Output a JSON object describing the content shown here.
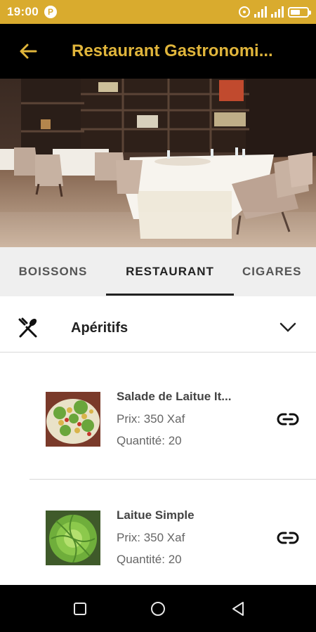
{
  "status_bar": {
    "time": "19:00",
    "notification_letter": "P"
  },
  "app_bar": {
    "title": "Restaurant Gastronomi..."
  },
  "tabs": [
    {
      "label": "BOISSONS"
    },
    {
      "label": "RESTAURANT"
    },
    {
      "label": "CIGARES"
    }
  ],
  "active_tab": "RESTAURANT",
  "section": {
    "title": "Apéritifs"
  },
  "items": [
    {
      "name": "Salade de Laitue It...",
      "price": "Prix: 350 Xaf",
      "quantity": "Quantité: 20",
      "thumb_icon": "salad-photo"
    },
    {
      "name": "Laitue Simple",
      "price": "Prix: 350 Xaf",
      "quantity": "Quantité: 20",
      "thumb_icon": "lettuce-photo"
    }
  ],
  "colors": {
    "accent": "#d9ab2e",
    "title_gold": "#e0b53b",
    "app_bar": "#000000"
  }
}
